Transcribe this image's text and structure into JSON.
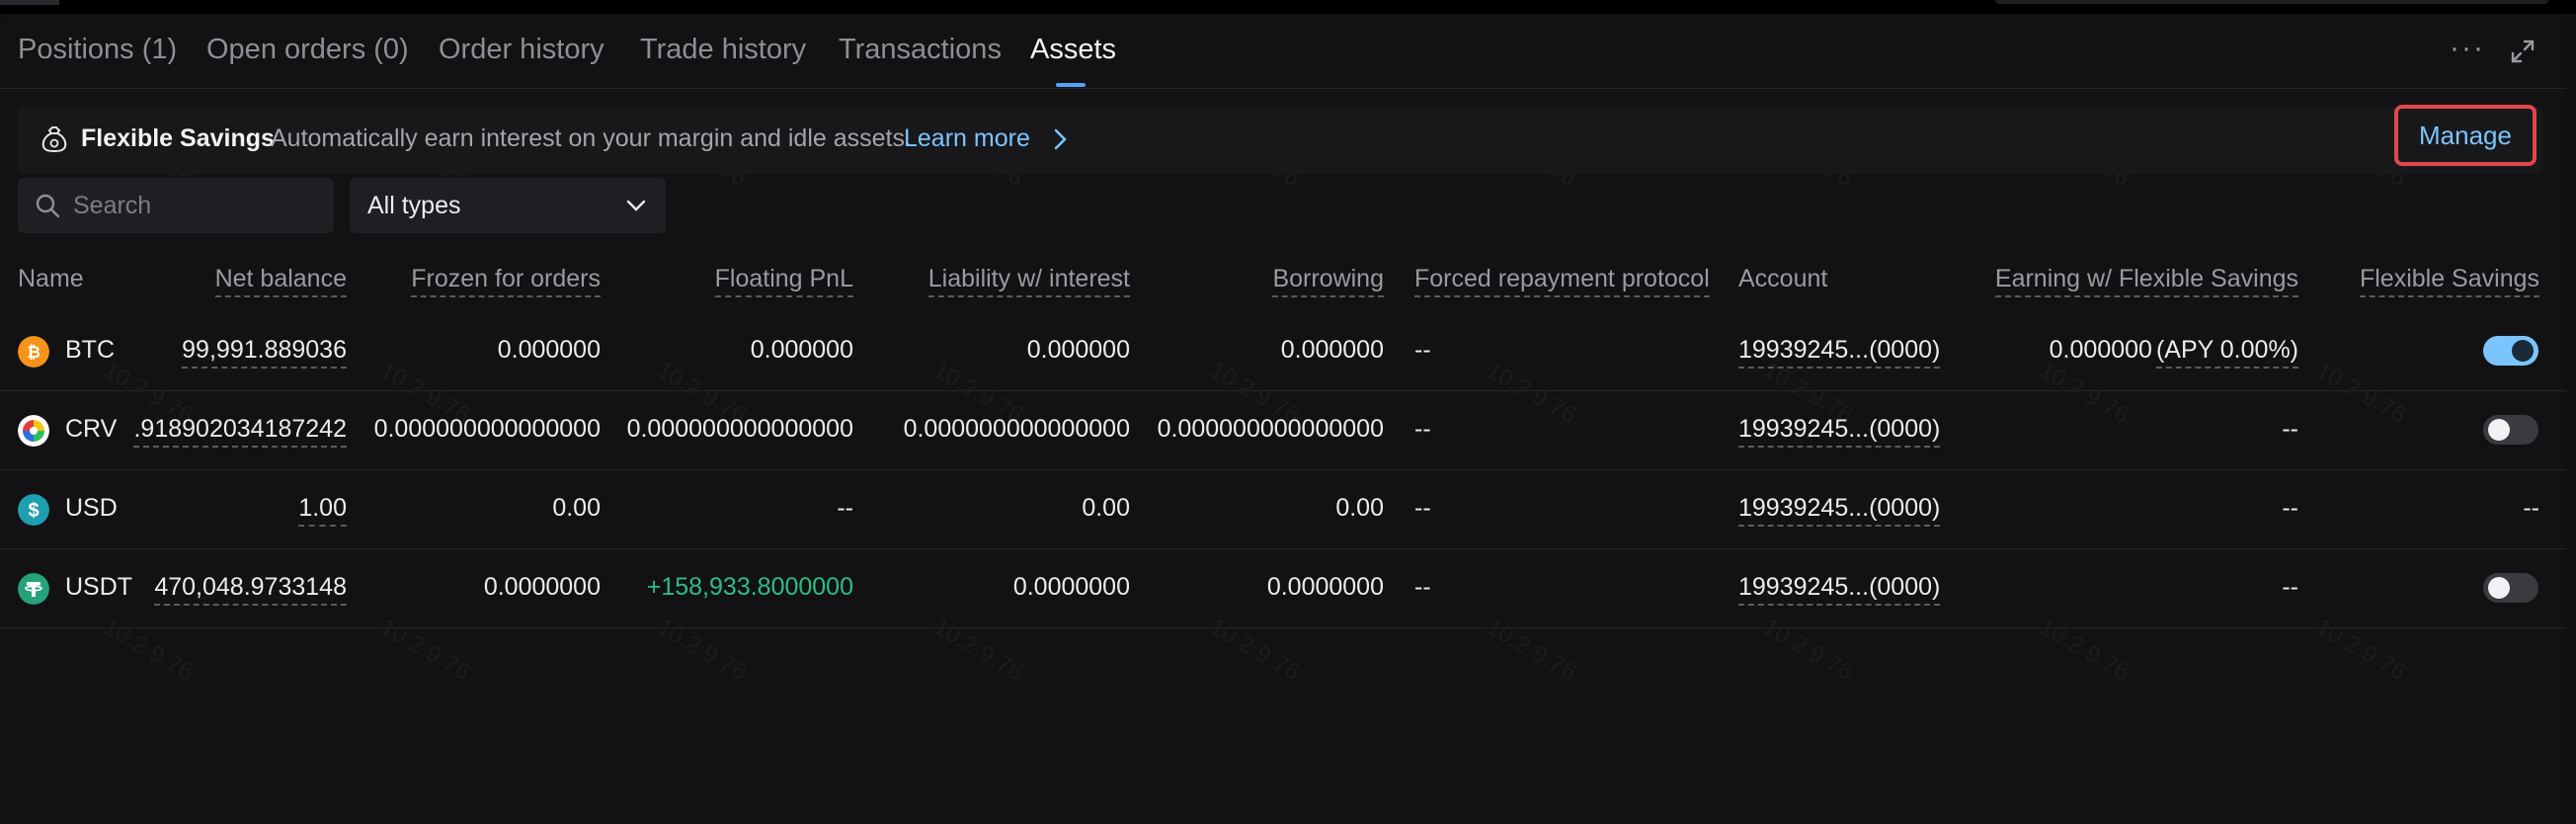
{
  "tabs": {
    "positions": "Positions (1)",
    "open_orders": "Open orders (0)",
    "order_history": "Order history",
    "trade_history": "Trade history",
    "transactions": "Transactions",
    "assets": "Assets"
  },
  "header_icons": {
    "more": "more-icon",
    "expand": "expand-icon"
  },
  "banner": {
    "title": "Flexible Savings",
    "description": "Automatically earn interest on your margin and idle assets.",
    "learn_more": "Learn more",
    "manage": "Manage"
  },
  "filters": {
    "search_placeholder": "Search",
    "type_selected": "All types"
  },
  "table": {
    "headers": {
      "name": "Name",
      "net_balance": "Net balance",
      "frozen": "Frozen for orders",
      "floating_pnl": "Floating PnL",
      "liability": "Liability w/ interest",
      "borrowing": "Borrowing",
      "forced_repayment": "Forced repayment protocol",
      "account": "Account",
      "earning": "Earning w/ Flexible Savings",
      "flexible_savings": "Flexible Savings"
    },
    "rows": [
      {
        "coin": "BTC",
        "net_balance": "99,991.889036",
        "frozen": "0.000000",
        "floating_pnl": "0.000000",
        "liability": "0.000000",
        "borrowing": "0.000000",
        "forced_repayment": "--",
        "account": "19939245...(0000)",
        "earning_value": "0.000000",
        "earning_apy": "(APY 0.00%)",
        "flexible_savings": "on"
      },
      {
        "coin": "CRV",
        "net_balance": ".918902034187242",
        "frozen": "0.000000000000000",
        "floating_pnl": "0.000000000000000",
        "liability": "0.000000000000000",
        "borrowing": "0.000000000000000",
        "forced_repayment": "--",
        "account": "19939245...(0000)",
        "earning": "--",
        "flexible_savings": "off"
      },
      {
        "coin": "USD",
        "net_balance": "1.00",
        "frozen": "0.00",
        "floating_pnl": "--",
        "liability": "0.00",
        "borrowing": "0.00",
        "forced_repayment": "--",
        "account": "19939245...(0000)",
        "earning": "--",
        "flexible_savings": "--"
      },
      {
        "coin": "USDT",
        "net_balance": "470,048.9733148",
        "frozen": "0.0000000",
        "floating_pnl": "+158,933.8000000",
        "liability": "0.0000000",
        "borrowing": "0.0000000",
        "forced_repayment": "--",
        "account": "19939245...(0000)",
        "earning": "--",
        "flexible_savings": "off"
      }
    ]
  },
  "watermark": "10.2.9.76",
  "colors": {
    "accent": "#7cc4ff",
    "tab_indicator": "#4ea6ff",
    "positive": "#2ebd85",
    "highlight_border": "#e0474d"
  }
}
